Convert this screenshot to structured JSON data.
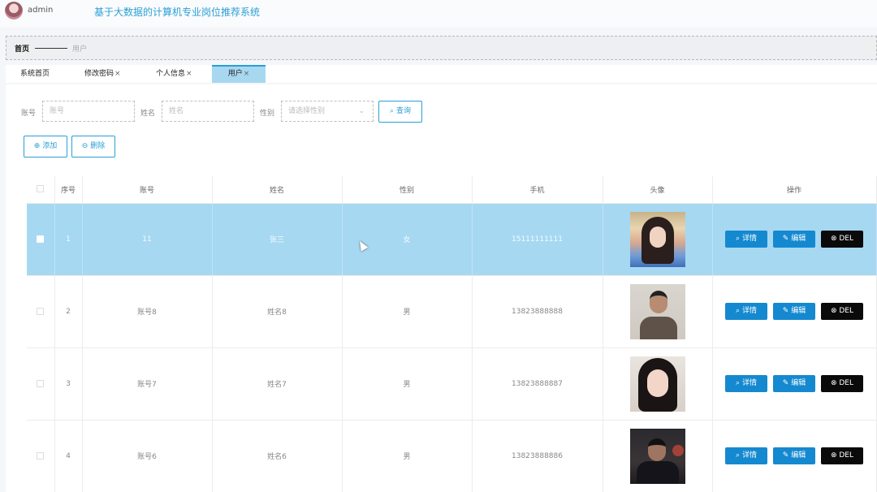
{
  "header": {
    "username": "admin",
    "app_title": "基于大数据的计算机专业岗位推荐系统"
  },
  "breadcrumb": {
    "home": "首页",
    "current": "用户"
  },
  "tabs": [
    {
      "label": "系统首页",
      "closable": false
    },
    {
      "label": "修改密码",
      "closable": true
    },
    {
      "label": "个人信息",
      "closable": true
    },
    {
      "label": "用户",
      "closable": true,
      "active": true
    }
  ],
  "tab_close_glyph": "×",
  "search": {
    "account_label": "账号",
    "account_placeholder": "账号",
    "name_label": "姓名",
    "name_placeholder": "姓名",
    "gender_label": "性别",
    "gender_placeholder": "请选择性别",
    "query_label": "查询"
  },
  "actions": {
    "add_label": "添加",
    "delete_label": "删除"
  },
  "table": {
    "columns": [
      "序号",
      "账号",
      "姓名",
      "性别",
      "手机",
      "头像",
      "操作"
    ],
    "rows": [
      {
        "index": "1",
        "account": "11",
        "name": "张三",
        "gender": "女",
        "phone": "15111111111",
        "selected": true
      },
      {
        "index": "2",
        "account": "账号8",
        "name": "姓名8",
        "gender": "男",
        "phone": "13823888888",
        "selected": false
      },
      {
        "index": "3",
        "account": "账号7",
        "name": "姓名7",
        "gender": "男",
        "phone": "13823888887",
        "selected": false
      },
      {
        "index": "4",
        "account": "账号6",
        "name": "姓名6",
        "gender": "男",
        "phone": "13823888886",
        "selected": false
      }
    ],
    "op_labels": {
      "detail": "详情",
      "edit": "编辑",
      "del": "DEL"
    }
  },
  "colors": {
    "accent": "#2aa0d6",
    "selected_row": "#a6d8f2",
    "op_primary": "#1589d0",
    "op_danger": "#0a0a0a"
  }
}
